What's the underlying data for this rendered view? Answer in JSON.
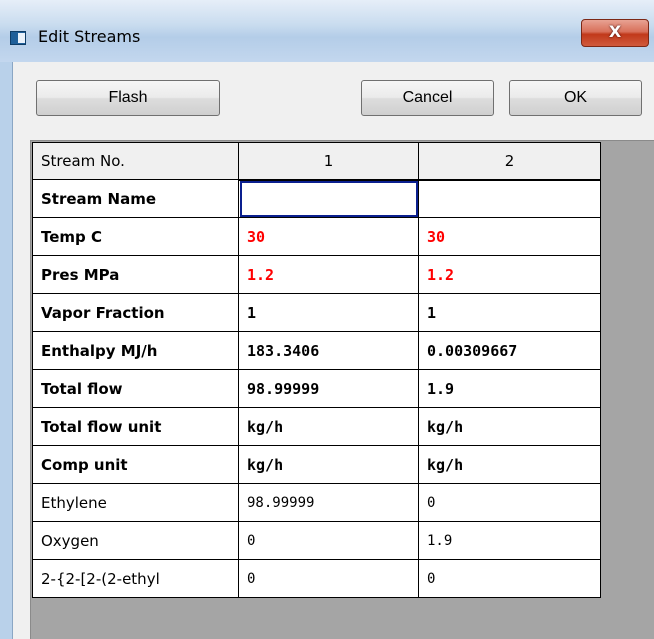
{
  "window": {
    "title": "Edit Streams",
    "close_label": "X"
  },
  "toolbar": {
    "flash_label": "Flash",
    "cancel_label": "Cancel",
    "ok_label": "OK"
  },
  "grid": {
    "header_label": "Stream No.",
    "columns": [
      "1",
      "2"
    ],
    "rows": [
      {
        "label": "Stream Name",
        "values": [
          "",
          ""
        ],
        "bold": true,
        "red": false
      },
      {
        "label": "Temp  C",
        "values": [
          "30",
          "30"
        ],
        "bold": true,
        "red": true
      },
      {
        "label": "Pres  MPa",
        "values": [
          "1.2",
          "1.2"
        ],
        "bold": true,
        "red": true
      },
      {
        "label": "Vapor Fraction",
        "values": [
          "1",
          "1"
        ],
        "bold": true,
        "red": false
      },
      {
        "label": "Enthalpy MJ/h",
        "values": [
          "183.3406",
          "0.00309667"
        ],
        "bold": true,
        "red": false
      },
      {
        "label": "Total flow",
        "values": [
          "98.99999",
          "1.9"
        ],
        "bold": true,
        "red": false
      },
      {
        "label": "Total flow unit",
        "values": [
          "kg/h",
          "kg/h"
        ],
        "bold": true,
        "red": false
      },
      {
        "label": "Comp unit",
        "values": [
          "kg/h",
          "kg/h"
        ],
        "bold": true,
        "red": false
      },
      {
        "label": "Ethylene",
        "values": [
          "98.99999",
          "0"
        ],
        "bold": false,
        "red": false
      },
      {
        "label": "Oxygen",
        "values": [
          "0",
          "1.9"
        ],
        "bold": false,
        "red": false
      },
      {
        "label": "2-{2-[2-(2-ethyl",
        "values": [
          "0",
          "0"
        ],
        "bold": false,
        "red": false
      }
    ]
  },
  "colors": {
    "input_value": "#ff0000",
    "selection": "#0a1f8f",
    "title_bar": "#c9dcef",
    "close_button": "#c1391b"
  }
}
